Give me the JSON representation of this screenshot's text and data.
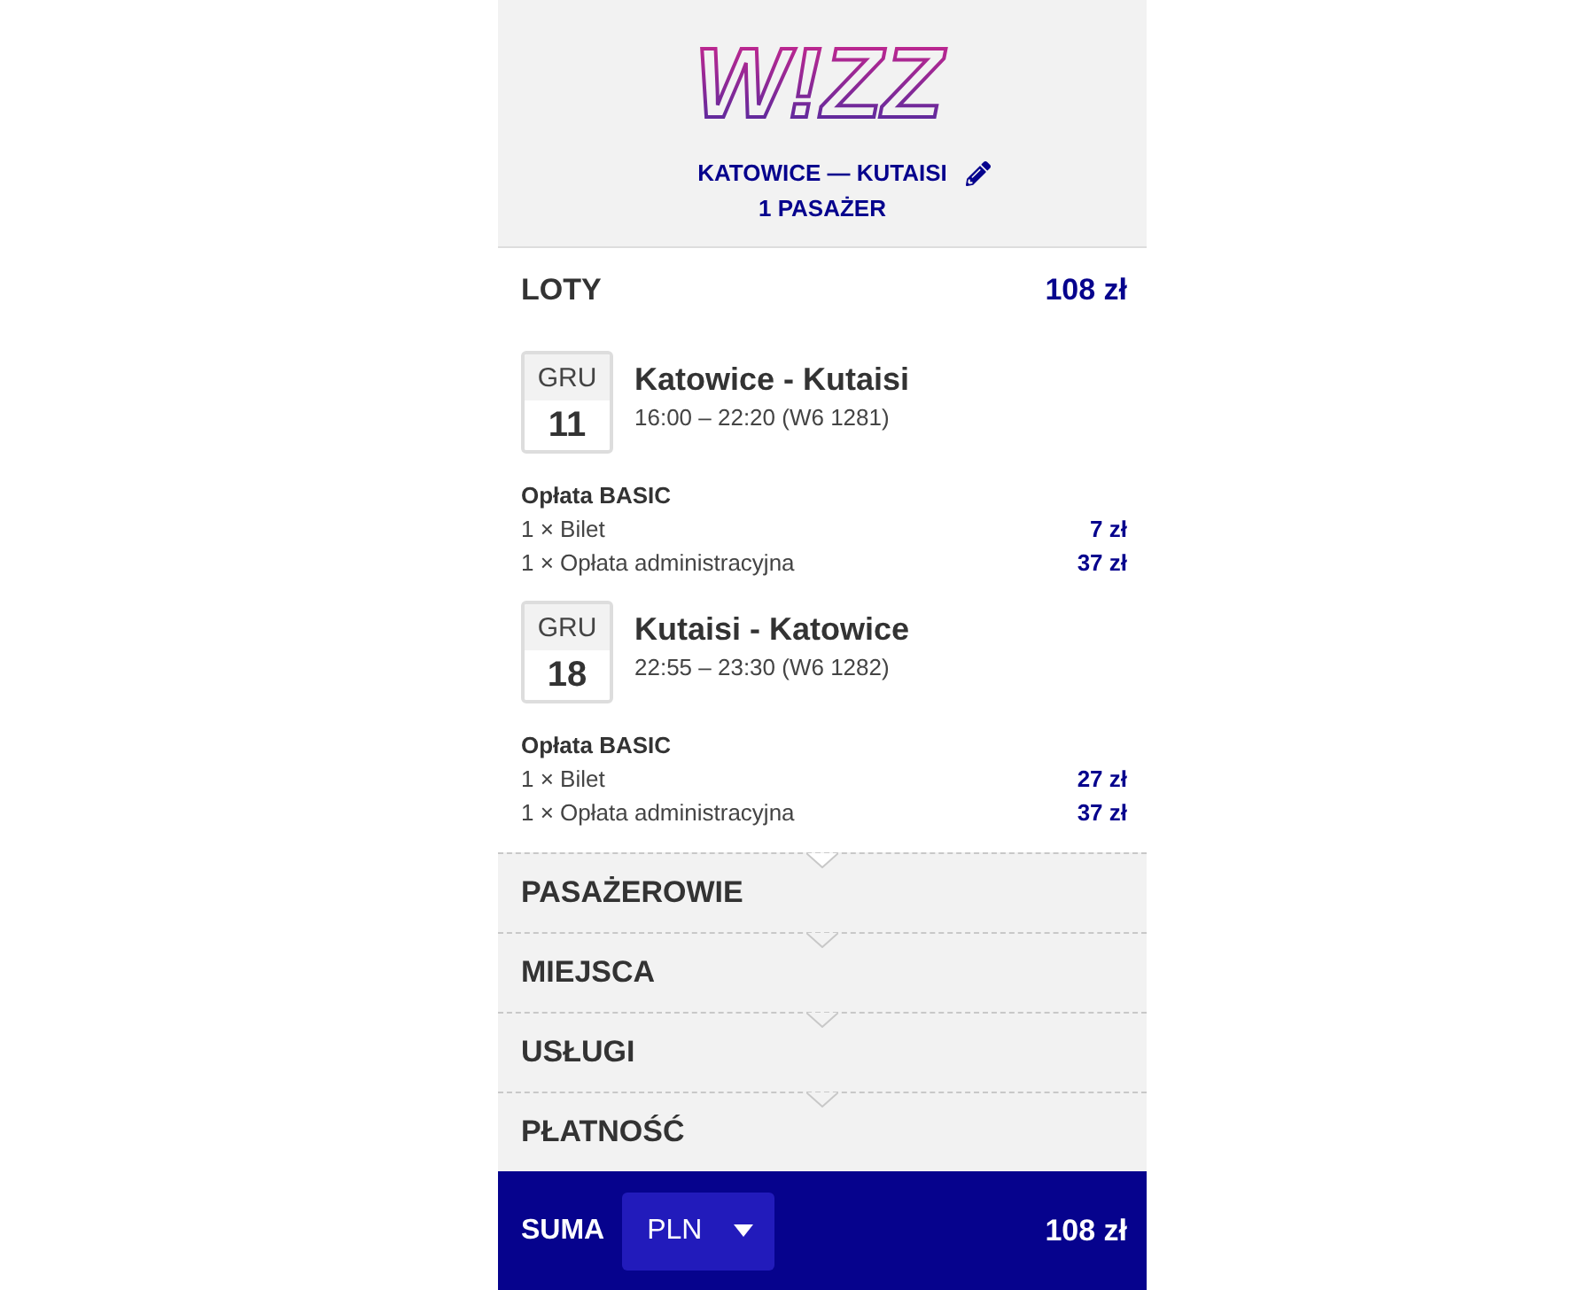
{
  "header": {
    "logo": "W!ZZ",
    "route": "KATOWICE — KUTAISI",
    "passengers": "1 PASAŻER"
  },
  "flights_section": {
    "title": "LOTY",
    "total": "108 zł",
    "flights": [
      {
        "month": "GRU",
        "day": "11",
        "route": "Katowice - Kutaisi",
        "times": "16:00 – 22:20 (W6 1281)",
        "fare_title": "Opłata BASIC",
        "fees": [
          {
            "label": "1 × Bilet",
            "amount": "7 zł"
          },
          {
            "label": "1 × Opłata administracyjna",
            "amount": "37 zł"
          }
        ]
      },
      {
        "month": "GRU",
        "day": "18",
        "route": "Kutaisi - Katowice",
        "times": "22:55 – 23:30 (W6 1282)",
        "fare_title": "Opłata BASIC",
        "fees": [
          {
            "label": "1 × Bilet",
            "amount": "27 zł"
          },
          {
            "label": "1 × Opłata administracyjna",
            "amount": "37 zł"
          }
        ]
      }
    ]
  },
  "sections": [
    {
      "title": "PASAŻEROWIE"
    },
    {
      "title": "MIEJSCA"
    },
    {
      "title": "USŁUGI"
    },
    {
      "title": "PŁATNOŚĆ"
    }
  ],
  "footer": {
    "label": "SUMA",
    "currency": "PLN",
    "total": "108 zł"
  }
}
